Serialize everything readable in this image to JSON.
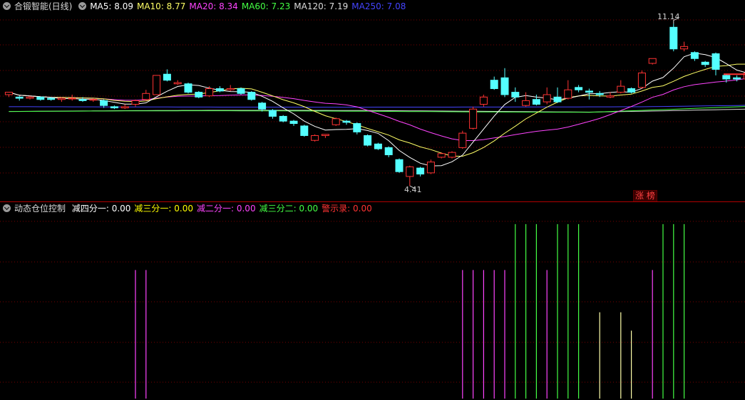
{
  "top": {
    "title": "合锻智能(日线)",
    "ma": [
      {
        "label": "MA5: 8.09",
        "color": "#ffffff"
      },
      {
        "label": "MA10: 8.77",
        "color": "#ffff66"
      },
      {
        "label": "MA20: 8.34",
        "color": "#ff44ff"
      },
      {
        "label": "MA60: 7.23",
        "color": "#44ff44"
      },
      {
        "label": "MA120: 7.19",
        "color": "#dddddd"
      },
      {
        "label": "MA250: 7.08",
        "color": "#4444ff"
      }
    ],
    "high_label": "11.14",
    "low_label": "4.41",
    "badge": "涨 榜"
  },
  "bottom": {
    "title": "动态仓位控制",
    "items": [
      {
        "label": "减四分一: 0.00",
        "color": "#ffffff"
      },
      {
        "label": "减三分一: 0.00",
        "color": "#ffff00"
      },
      {
        "label": "减二分一: 0.00",
        "color": "#ff44ff"
      },
      {
        "label": "减三分二: 0.00",
        "color": "#44ff44"
      },
      {
        "label": "警示录: 0.00",
        "color": "#ff3333"
      }
    ]
  },
  "chart_data": {
    "type": "candlestick",
    "ylim": [
      4.0,
      11.6
    ],
    "candles": [
      [
        8.2,
        8.3,
        8.3,
        8.1
      ],
      [
        8.1,
        8.05,
        8.15,
        7.95
      ],
      [
        8.05,
        8.1,
        8.15,
        8.0
      ],
      [
        8.1,
        8.0,
        8.1,
        7.95
      ],
      [
        8.05,
        8.0,
        8.1,
        7.95
      ],
      [
        8.0,
        8.05,
        8.1,
        7.9
      ],
      [
        8.05,
        8.05,
        8.2,
        7.95
      ],
      [
        8.0,
        7.95,
        8.1,
        7.9
      ],
      [
        8.0,
        8.0,
        8.05,
        7.9
      ],
      [
        7.95,
        7.75,
        8.0,
        7.65
      ],
      [
        7.7,
        7.65,
        7.75,
        7.6
      ],
      [
        7.65,
        7.7,
        7.8,
        7.6
      ],
      [
        7.8,
        7.95,
        8.0,
        7.7
      ],
      [
        8.0,
        8.25,
        8.4,
        7.95
      ],
      [
        8.2,
        9.0,
        9.0,
        8.2
      ],
      [
        9.05,
        8.8,
        9.25,
        8.75
      ],
      [
        8.65,
        8.7,
        8.8,
        8.6
      ],
      [
        8.65,
        8.3,
        8.7,
        8.25
      ],
      [
        8.3,
        8.1,
        8.35,
        8.05
      ],
      [
        8.15,
        8.45,
        8.55,
        8.1
      ],
      [
        8.45,
        8.35,
        8.55,
        8.3
      ],
      [
        8.4,
        8.45,
        8.6,
        8.35
      ],
      [
        8.45,
        8.25,
        8.5,
        8.2
      ],
      [
        8.3,
        8.0,
        8.35,
        7.95
      ],
      [
        7.85,
        7.6,
        7.9,
        7.5
      ],
      [
        7.55,
        7.3,
        7.6,
        7.2
      ],
      [
        7.3,
        7.1,
        7.35,
        7.05
      ],
      [
        7.1,
        7.0,
        7.15,
        6.9
      ],
      [
        6.9,
        6.5,
        6.95,
        6.45
      ],
      [
        6.3,
        6.5,
        6.55,
        6.25
      ],
      [
        6.5,
        6.55,
        6.55,
        6.4
      ],
      [
        6.95,
        7.2,
        7.25,
        6.9
      ],
      [
        7.1,
        7.05,
        7.15,
        6.95
      ],
      [
        7.0,
        6.65,
        7.05,
        6.55
      ],
      [
        6.5,
        6.1,
        6.55,
        6.05
      ],
      [
        6.15,
        5.95,
        6.2,
        5.9
      ],
      [
        6.0,
        5.7,
        6.05,
        5.6
      ],
      [
        5.5,
        5.0,
        5.55,
        4.95
      ],
      [
        4.8,
        5.2,
        5.25,
        4.41
      ],
      [
        5.15,
        4.9,
        5.2,
        4.8
      ],
      [
        4.95,
        5.4,
        5.5,
        4.9
      ],
      [
        5.6,
        5.75,
        5.8,
        5.55
      ],
      [
        5.6,
        5.8,
        5.85,
        5.55
      ],
      [
        6.0,
        6.6,
        6.7,
        5.95
      ],
      [
        6.8,
        7.6,
        7.7,
        6.75
      ],
      [
        7.8,
        8.1,
        8.2,
        7.7
      ],
      [
        8.8,
        8.45,
        8.95,
        8.4
      ],
      [
        8.9,
        8.2,
        9.3,
        8.1
      ],
      [
        8.3,
        8.1,
        8.5,
        7.9
      ],
      [
        7.75,
        7.95,
        8.3,
        7.7
      ],
      [
        8.0,
        7.8,
        8.2,
        7.75
      ],
      [
        7.9,
        8.2,
        8.5,
        7.8
      ],
      [
        8.1,
        7.9,
        8.5,
        7.85
      ],
      [
        8.05,
        8.4,
        8.8,
        8.0
      ],
      [
        8.5,
        8.4,
        8.6,
        8.3
      ],
      [
        8.35,
        8.3,
        8.45,
        8.0
      ],
      [
        8.25,
        8.2,
        8.35,
        8.1
      ],
      [
        8.1,
        8.15,
        8.3,
        8.05
      ],
      [
        8.3,
        8.55,
        8.8,
        8.25
      ],
      [
        8.45,
        8.3,
        8.5,
        8.25
      ],
      [
        8.5,
        9.1,
        9.2,
        8.45
      ],
      [
        9.5,
        9.7,
        9.7,
        9.45
      ],
      [
        null,
        null,
        null,
        null
      ],
      [
        11.0,
        10.1,
        11.14,
        10.0
      ],
      [
        10.1,
        10.2,
        10.4,
        10.0
      ],
      [
        9.95,
        9.7,
        10.0,
        9.6
      ],
      [
        9.55,
        9.45,
        9.6,
        9.35
      ],
      [
        9.9,
        9.25,
        9.95,
        9.0
      ],
      [
        9.0,
        8.85,
        9.05,
        8.7
      ],
      [
        8.9,
        8.85,
        9.0,
        8.75
      ],
      [
        8.85,
        9.1,
        9.15,
        8.8
      ],
      [
        9.2,
        9.05,
        9.25,
        9.0
      ]
    ],
    "signals_bottom": [
      {
        "i": 12,
        "color": "#ff44ff",
        "h": 0.7
      },
      {
        "i": 13,
        "color": "#ff44ff",
        "h": 0.7
      },
      {
        "i": 43,
        "color": "#ff44ff",
        "h": 0.7
      },
      {
        "i": 44,
        "color": "#ff44ff",
        "h": 0.7
      },
      {
        "i": 45,
        "color": "#ff44ff",
        "h": 0.7
      },
      {
        "i": 46,
        "color": "#ff44ff",
        "h": 0.7
      },
      {
        "i": 47,
        "color": "#ff44ff",
        "h": 0.7
      },
      {
        "i": 48,
        "color": "#44ff44",
        "h": 0.95
      },
      {
        "i": 49,
        "color": "#44ff44",
        "h": 0.95
      },
      {
        "i": 50,
        "color": "#44ff44",
        "h": 0.95
      },
      {
        "i": 51,
        "color": "#ff44ff",
        "h": 0.7
      },
      {
        "i": 52,
        "color": "#44ff44",
        "h": 0.95
      },
      {
        "i": 53,
        "color": "#44ff44",
        "h": 0.95
      },
      {
        "i": 54,
        "color": "#44ff44",
        "h": 0.95
      },
      {
        "i": 56,
        "color": "#ffffaa",
        "h": 0.47
      },
      {
        "i": 58,
        "color": "#ffffaa",
        "h": 0.47
      },
      {
        "i": 59,
        "color": "#ffffaa",
        "h": 0.37
      },
      {
        "i": 61,
        "color": "#ff44ff",
        "h": 0.7
      },
      {
        "i": 62,
        "color": "#44ff44",
        "h": 0.95
      },
      {
        "i": 63,
        "color": "#44ff44",
        "h": 0.95
      },
      {
        "i": 64,
        "color": "#44ff44",
        "h": 0.95
      }
    ]
  }
}
